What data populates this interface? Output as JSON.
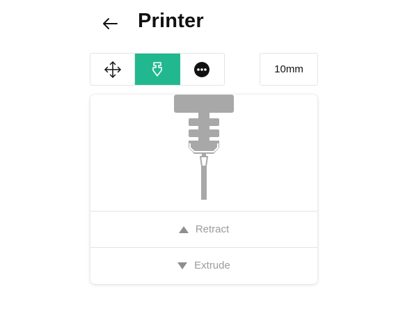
{
  "header": {
    "back_icon": "arrow-left-icon",
    "title": "Printer"
  },
  "modes": [
    {
      "icon": "move-arrows-icon",
      "active": false
    },
    {
      "icon": "extruder-icon",
      "active": true
    },
    {
      "icon": "more-dots-icon",
      "active": false
    }
  ],
  "step": {
    "label": "10mm"
  },
  "extruder_panel": {
    "illustration_icon": "print-nozzle-icon",
    "retract_label": "Retract",
    "extrude_label": "Extrude"
  },
  "colors": {
    "accent": "#22b88f",
    "muted_text": "#9b9b9b",
    "illustration": "#a8a8a8"
  }
}
